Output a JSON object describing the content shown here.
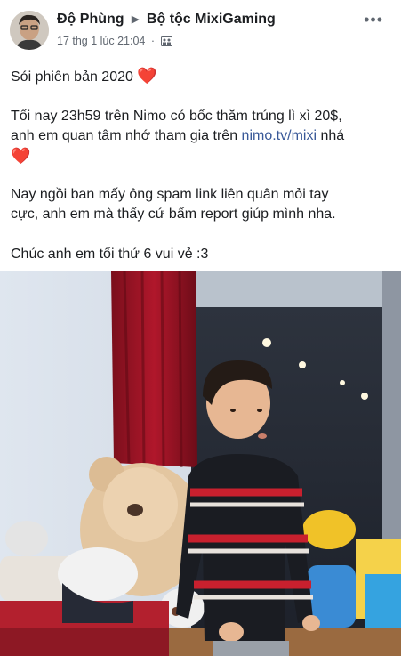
{
  "post": {
    "author": "Độ Phùng",
    "group": "Bộ tộc MixiGaming",
    "timestamp": "17 thg 1 lúc 21:04",
    "privacy_icon": "group-icon",
    "more_label": "•••"
  },
  "content": {
    "line1": "Sói phiên bản 2020",
    "line2a": "Tối nay 23h59 trên Nimo có bốc thăm trúng lì xì 20$,",
    "line2b": "anh em quan tâm nhớ tham gia trên",
    "link": "nimo.tv/mixi",
    "line2c": "nhá",
    "line3a": "Nay ngồi ban mấy ông spam link liên quân mỏi tay",
    "line3b": "cực, anh em mà thấy cứ bấm report giúp mình nha.",
    "line4": "Chúc anh em tối thứ 6 vui vẻ :3",
    "heart": "❤️"
  },
  "colors": {
    "link": "#385898",
    "meta": "#606770",
    "heart": "#e0245e"
  }
}
